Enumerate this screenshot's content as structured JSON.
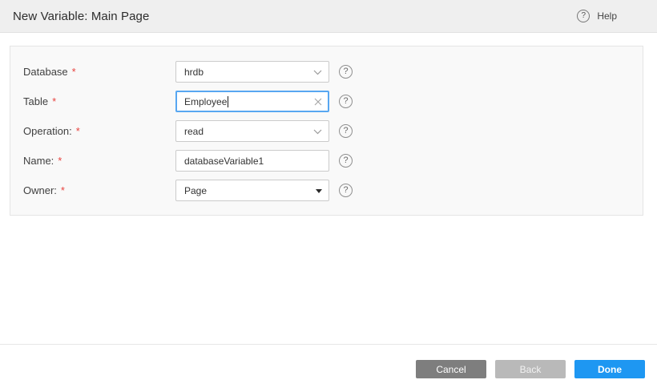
{
  "header": {
    "title": "New Variable: Main Page",
    "help": {
      "label": "Help"
    }
  },
  "icons": {
    "help_glyph": "?"
  },
  "form": {
    "fields": [
      {
        "label": "Database",
        "required_mark": "*",
        "value": "hrdb",
        "control": "dropdown"
      },
      {
        "label": "Table",
        "required_mark": "*",
        "value": "Employee",
        "control": "text",
        "focused": true,
        "clearable": true
      },
      {
        "label": "Operation:",
        "required_mark": "*",
        "value": "read",
        "control": "dropdown"
      },
      {
        "label": "Name:",
        "required_mark": "*",
        "value": "databaseVariable1",
        "control": "text"
      },
      {
        "label": "Owner:",
        "required_mark": "*",
        "value": "Page",
        "control": "select"
      }
    ]
  },
  "footer": {
    "buttons": [
      {
        "label": "Cancel"
      },
      {
        "label": "Back"
      },
      {
        "label": "Done"
      }
    ]
  },
  "colors": {
    "done_blue": "#1e97f2",
    "focus_border": "#58a7f1",
    "required_red": "#e8433f",
    "cancel_gray": "#7e7e7e",
    "back_gray": "#b9b9b9",
    "header_bg": "#efefef",
    "panel_bg": "#f9f9f9"
  }
}
